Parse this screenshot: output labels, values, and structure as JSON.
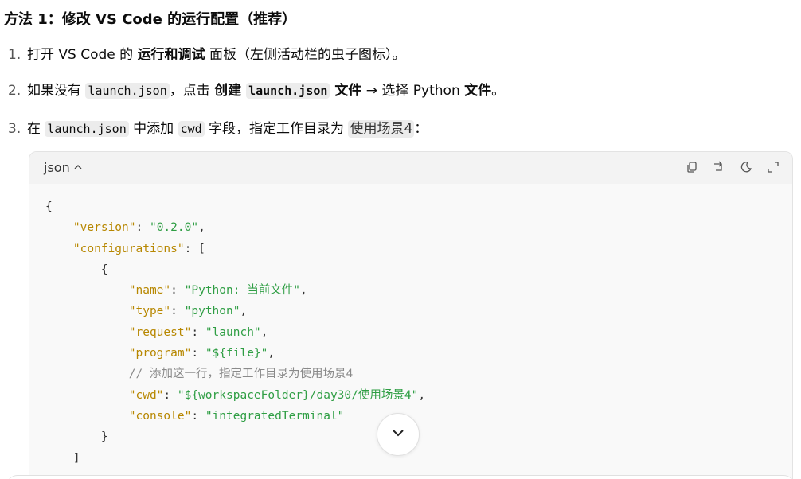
{
  "heading": "方法 1：修改 VS Code 的运行配置（推荐）",
  "steps": [
    {
      "num": "1.",
      "a": "打开 VS Code 的 ",
      "b": "运行和调试",
      "c": " 面板（左侧活动栏的虫子图标）。"
    },
    {
      "num": "2.",
      "a": "如果没有 ",
      "code1": "launch.json",
      "b": "，点击 ",
      "bold1": "创建 ",
      "code2": "launch.json",
      "bold2": " 文件",
      "c": " → 选择 Python ",
      "bold3": "文件",
      "d": "。"
    },
    {
      "num": "3.",
      "a": "在 ",
      "code1": "launch.json",
      "b": " 中添加 ",
      "code2": "cwd",
      "c": " 字段，指定工作目录为 ",
      "hl": "使用场景4",
      "d": "："
    }
  ],
  "codeblock": {
    "lang": "json",
    "icons": [
      "copy-icon",
      "share-icon",
      "theme-icon",
      "expand-icon"
    ],
    "lines": {
      "l1": "{",
      "l2k": "\"version\"",
      "l2v": "\"0.2.0\"",
      "l3k": "\"configurations\"",
      "l4": "{",
      "l5k": "\"name\"",
      "l5v": "\"Python: 当前文件\"",
      "l6k": "\"type\"",
      "l6v": "\"python\"",
      "l7k": "\"request\"",
      "l7v": "\"launch\"",
      "l8k": "\"program\"",
      "l8v": "\"${file}\"",
      "l9": "// 添加这一行，指定工作目录为使用场景4",
      "l10k": "\"cwd\"",
      "l10v": "\"${workspaceFolder}/day30/使用场景4\"",
      "l11k": "\"console\"",
      "l11v": "\"integratedTerminal\"",
      "l12": "}",
      "l13": "]"
    }
  }
}
